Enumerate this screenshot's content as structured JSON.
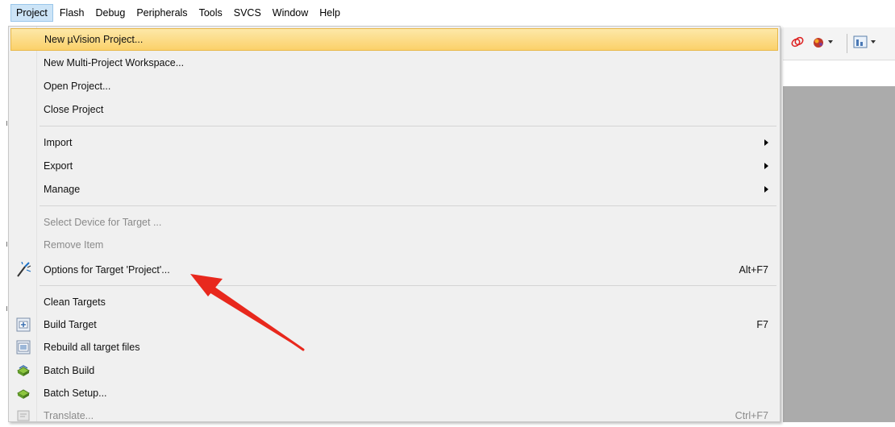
{
  "menubar": {
    "items": [
      "Project",
      "Flash",
      "Debug",
      "Peripherals",
      "Tools",
      "SVCS",
      "Window",
      "Help"
    ],
    "active_index": 0
  },
  "project_menu": {
    "new_uvision_project": "New µVision Project...",
    "new_multi_project_workspace": "New Multi-Project Workspace...",
    "open_project": "Open Project...",
    "close_project": "Close Project",
    "import": "Import",
    "export": "Export",
    "manage": "Manage",
    "select_device": "Select Device for Target ...",
    "remove_item": "Remove Item",
    "options_for_target": "Options for Target 'Project'...",
    "options_for_target_shortcut": "Alt+F7",
    "clean_targets": "Clean Targets",
    "build_target": "Build Target",
    "build_target_shortcut": "F7",
    "rebuild_all": "Rebuild all target files",
    "batch_build": "Batch Build",
    "batch_setup": "Batch Setup...",
    "translate": "Translate...",
    "translate_shortcut": "Ctrl+F7"
  },
  "icons": {
    "options": "magic-wand-icon",
    "build": "build-icon",
    "rebuild": "rebuild-icon",
    "batch_build": "batch-build-icon",
    "batch_setup": "batch-setup-icon",
    "translate": "translate-icon"
  },
  "colors": {
    "highlight": "#fbd16a",
    "arrow": "#e8281d",
    "menu_active": "#cce4f7"
  }
}
